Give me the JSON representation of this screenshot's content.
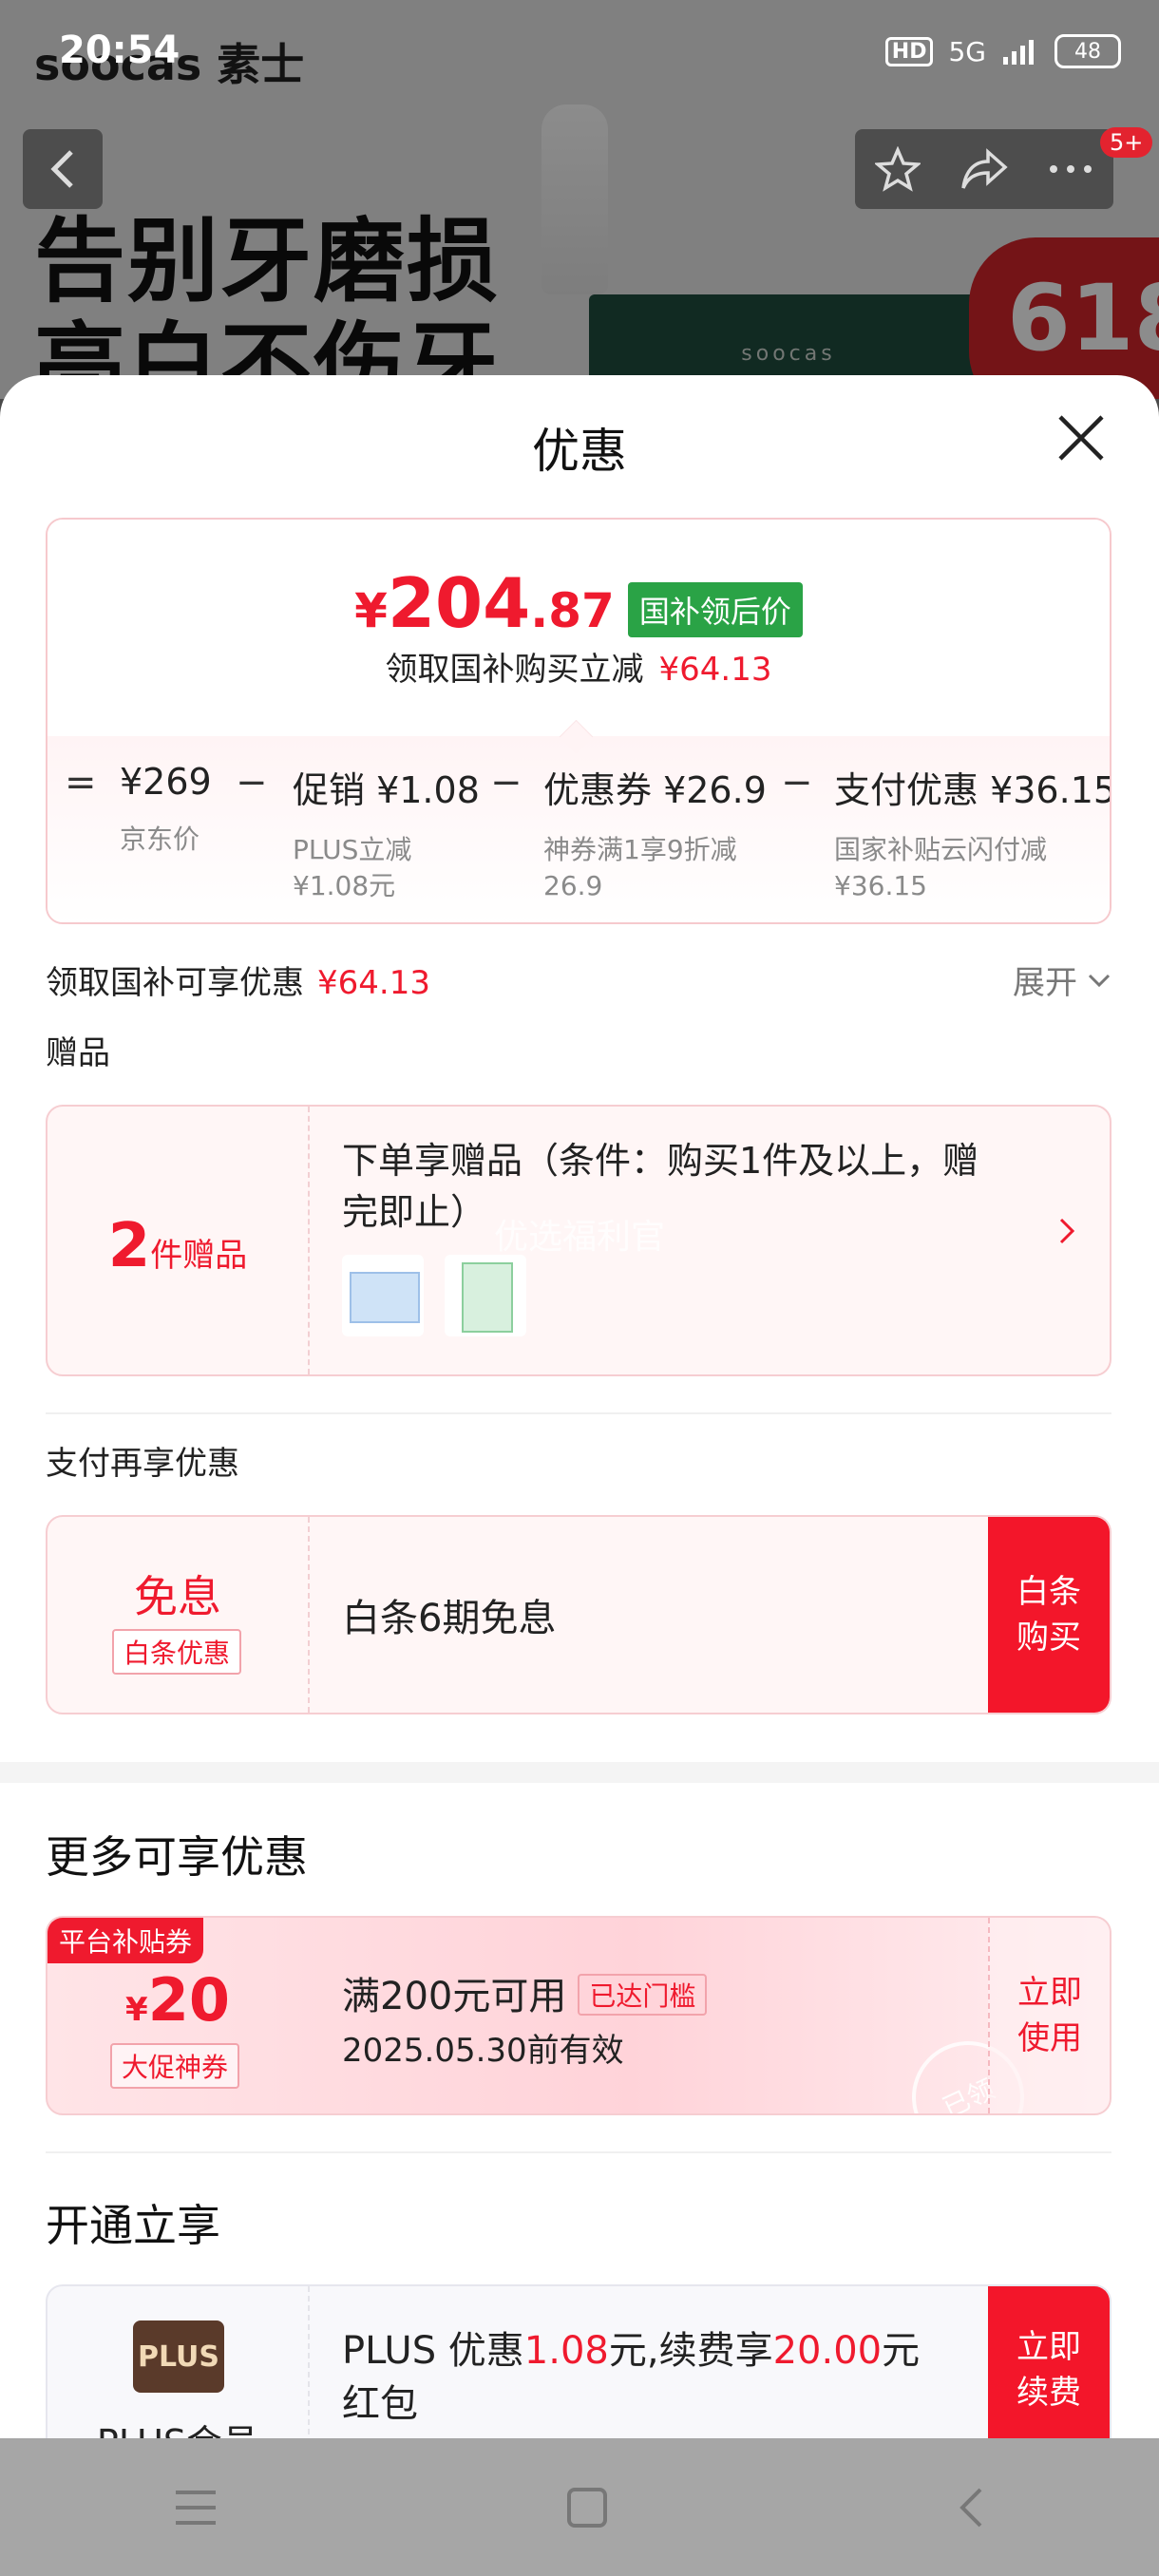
{
  "status_bar": {
    "time": "20:54",
    "network": "5G",
    "battery": "48"
  },
  "background_page": {
    "brand": "soocas 素士",
    "hero_line1": "告别牙磨损",
    "hero_line2": "亮白不伤牙",
    "box_brand": "soocas",
    "badge": "618",
    "cart_badge": "5+"
  },
  "sheet": {
    "title": "优惠",
    "price": {
      "currency": "¥",
      "integer": "204",
      "decimal": ".87",
      "tag": "国补领后价",
      "subsidy_text": "领取国补购买立减",
      "subsidy_amount": "¥64.13"
    },
    "breakdown": [
      {
        "op": "=",
        "value": "¥269",
        "desc": "京东价"
      },
      {
        "op": "−",
        "value": "促销 ¥1.08",
        "desc": "PLUS立减\n¥1.08元"
      },
      {
        "op": "−",
        "value": "优惠券 ¥26.9",
        "desc": "神券满1享9折减\n26.9"
      },
      {
        "op": "−",
        "value": "支付优惠 ¥36.15",
        "desc": "国家补贴云闪付减\n¥36.15"
      }
    ],
    "discount_row": {
      "label": "领取国补可享优惠",
      "amount": "¥64.13",
      "expand": "展开"
    },
    "gift_section": {
      "title": "赠品",
      "count": "2",
      "count_unit": "件赠品",
      "description": "下单享赠品（条件：购买1件及以上，赠完即止）",
      "watermark": "优选福利官"
    },
    "pay_section": {
      "title": "支付再享优惠",
      "label": "免息",
      "tag": "白条优惠",
      "description": "白条6期免息",
      "button": "白条\n购买"
    },
    "more_section": {
      "title": "更多可享优惠",
      "coupon_tag": "平台补贴券",
      "coupon_currency": "¥",
      "coupon_amount": "20",
      "coupon_type": "大促神券",
      "condition": "满200元可用",
      "reached": "已达门槛",
      "expiry": "2025.05.30前有效",
      "button": "立即\n使用",
      "stamp": "已领"
    },
    "open_section": {
      "title": "开通立享",
      "logo": "PLUS",
      "label": "PLUS会员",
      "desc_1": "PLUS 优惠",
      "desc_amount1": "1.08",
      "desc_2": "元,续费享",
      "desc_amount2": "20.00",
      "desc_3": "元红包",
      "button": "立即\n续费"
    }
  },
  "colors": {
    "accent_red": "#ef1a2e",
    "green_tag": "#2aa346",
    "button_red": "#f3162a"
  }
}
